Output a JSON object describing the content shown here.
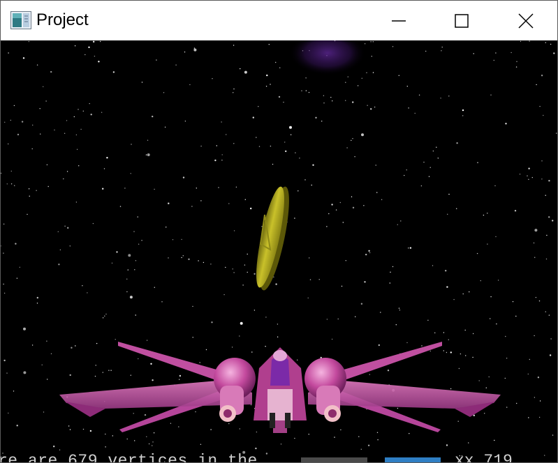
{
  "window": {
    "title": "Project",
    "icon": "application-window-icon",
    "controls": {
      "minimize": "minimize-icon",
      "maximize": "maximize-icon",
      "close": "close-icon"
    }
  },
  "scene": {
    "background": "starfield",
    "objects": [
      "spaceship",
      "gold-coin",
      "nebula"
    ],
    "colors": {
      "ship": "#c04fa0",
      "coin": "#b8b020",
      "nebula": "#4a1d7a",
      "space": "#000000"
    }
  },
  "hud": {
    "vertices_text": "re are 679 vertices in the",
    "right_text": "xx 719"
  }
}
